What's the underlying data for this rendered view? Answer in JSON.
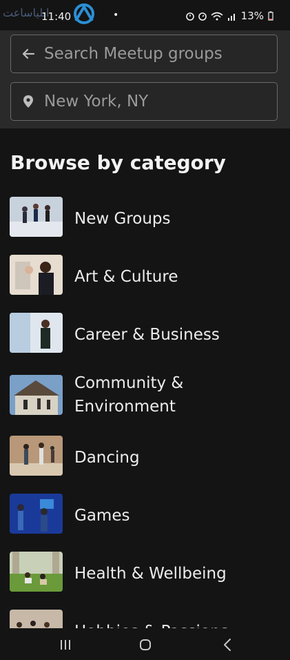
{
  "status": {
    "time": "11:40",
    "dot": "•",
    "battery": "13%"
  },
  "search": {
    "placeholder": "Search Meetup groups",
    "location": "New York, NY"
  },
  "browse": {
    "heading": "Browse by category",
    "categories": [
      {
        "label": "New Groups"
      },
      {
        "label": "Art & Culture"
      },
      {
        "label": "Career & Business"
      },
      {
        "label": "Community &",
        "label2": "Environment"
      },
      {
        "label": "Dancing"
      },
      {
        "label": "Games"
      },
      {
        "label": "Health & Wellbeing"
      },
      {
        "label": "Hobbies & Passions"
      }
    ]
  },
  "icons": {
    "back": "arrow-left-icon",
    "location": "location-pin-icon",
    "nav_recent": "recent-apps-icon",
    "nav_home": "home-icon",
    "nav_back": "back-icon"
  },
  "colors": {
    "background": "#141414",
    "search_area": "#2a2a2a",
    "text": "#ececec",
    "placeholder": "#9a9a9a"
  }
}
